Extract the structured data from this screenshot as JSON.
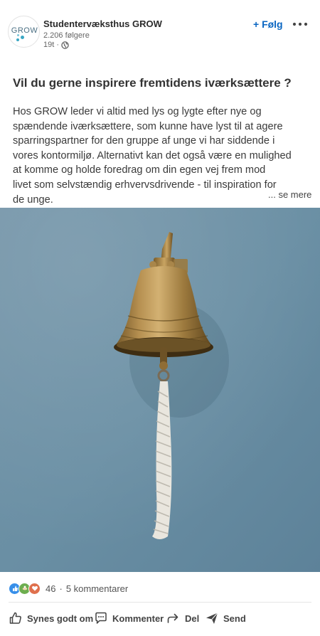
{
  "post": {
    "author": {
      "avatar_text": "GROW",
      "name": "Studentervæksthus GROW",
      "followers": "2.206 følgere",
      "time": "19t ·",
      "visibility_icon": "globe-icon"
    },
    "follow_label": "+ Følg",
    "more_icon": "more-icon",
    "title": "Vil du gerne inspirere fremtidens iværksættere ?",
    "body_lines": [
      "Hos GROW leder vi altid med lys og lygte efter nye og",
      "spændende iværksættere, som kunne have lyst til at agere",
      "sparringspartner for den gruppe af unge vi har siddende i",
      "vores kontormiljø. Alternativt kan det også være en mulighed",
      "at komme og holde foredrag om din egen vej frem mod",
      "livet som selvstændig erhvervsdrivende - til inspiration for",
      "de unge."
    ],
    "see_more": "... se mere",
    "image_icon": "brass-bell-photo"
  },
  "social": {
    "reaction_icons": [
      "like-icon",
      "support-icon",
      "love-icon"
    ],
    "reaction_count": "46",
    "separator": "·",
    "comments": "5 kommentarer"
  },
  "actions": {
    "like": "Synes godt om",
    "comment": "Kommenter",
    "share": "Del",
    "send": "Send"
  },
  "colors": {
    "accent": "#0a66c2",
    "wall": "#6a8fa4",
    "love": "#df704d",
    "like": "#378fe9",
    "support": "#6dae4f"
  }
}
